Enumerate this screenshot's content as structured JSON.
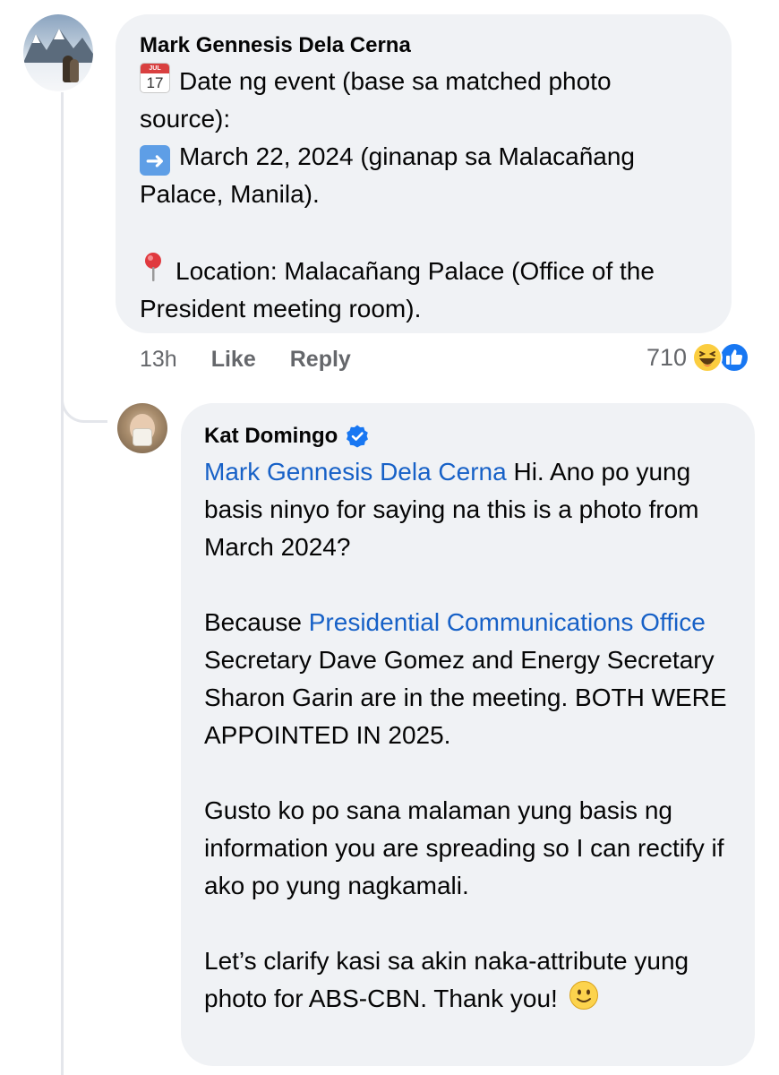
{
  "comment": {
    "author": "Mark Gennesis Dela Cerna",
    "calendar_emoji_label": "JUL",
    "calendar_emoji_number": "17",
    "line1": "Date ng event (base sa matched photo source):",
    "line2": "March 22, 2024 (ginanap sa Malacañang Palace, Manila).",
    "line3": "Location: Malacañang Palace (Office of the President meeting room).",
    "time": "13h",
    "like_label": "Like",
    "reply_label": "Reply",
    "reaction_count": "710",
    "reaction_icons": [
      "haha-icon",
      "like-icon"
    ]
  },
  "reply": {
    "author": "Kat Domingo",
    "verified": true,
    "mention1": "Mark Gennesis Dela Cerna",
    "p1_rest": " Hi. Ano po yung basis ninyo for saying na this is a photo from March 2024?",
    "p2_start": "Because ",
    "mention2": "Presidential Communications Office",
    "p2_rest": " Secretary Dave Gomez and Energy Secretary Sharon Garin are in the meeting. BOTH WERE APPOINTED IN 2025.",
    "p3": "Gusto ko po sana malaman yung basis ng information you are spreading so I can rectify if ako po yung nagkamali.",
    "p4": "Let’s clarify kasi sa akin naka-attribute yung photo for ABS-CBN. Thank you!"
  },
  "colors": {
    "bubble": "#f0f2f5",
    "mention": "#1761c7",
    "meta": "#65676b",
    "like_blue": "#1877f2"
  }
}
